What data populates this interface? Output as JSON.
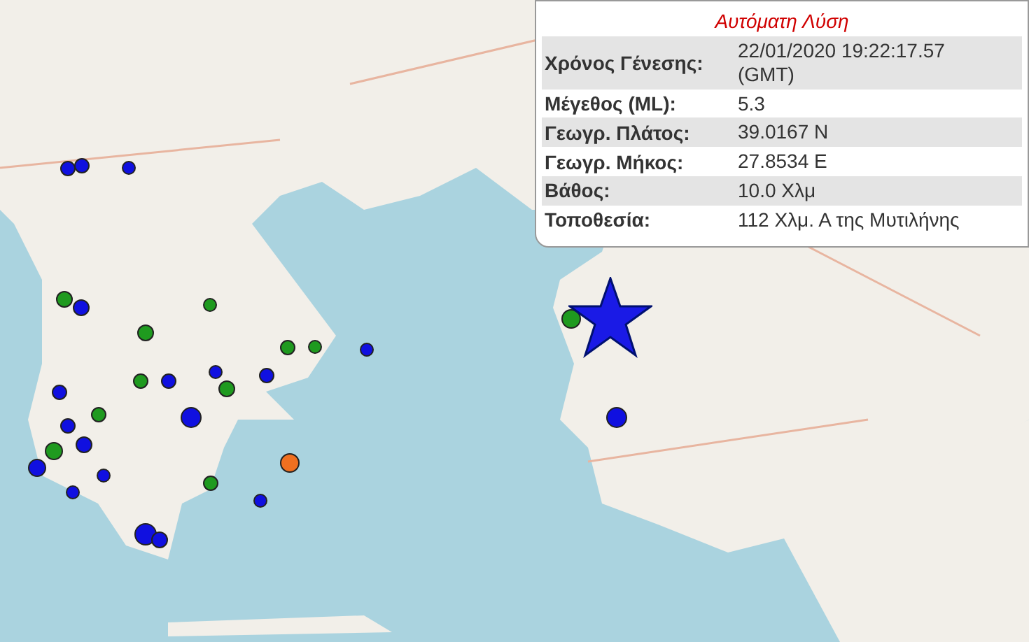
{
  "popup": {
    "title": "Αυτόματη Λύση",
    "rows": [
      {
        "label": "Χρόνος Γένεσης:",
        "value": "22/01/2020 19:22:17.57 (GMT)"
      },
      {
        "label": "Μέγεθος (ML):",
        "value": "5.3"
      },
      {
        "label": "Γεωγρ. Πλάτος:",
        "value": "39.0167 N"
      },
      {
        "label": "Γεωγρ. Μήκος:",
        "value": "27.8534 E"
      },
      {
        "label": "Βάθος:",
        "value": "10.0 Χλμ"
      },
      {
        "label": "Τοποθεσία:",
        "value": "112 Χλμ. Α της Μυτιλήνης"
      }
    ]
  },
  "markers": [
    {
      "color": "#1010e0"
    },
    {
      "color": "#1010e0"
    },
    {
      "color": "#1010e0"
    },
    {
      "color": "#1010e0"
    },
    {
      "color": "#1010e0"
    },
    {
      "color": "#1010e0"
    },
    {
      "color": "#1010e0"
    },
    {
      "color": "#1010e0"
    },
    {
      "color": "#1010e0"
    },
    {
      "color": "#1010e0"
    },
    {
      "color": "#1010e0"
    },
    {
      "color": "#1010e0"
    },
    {
      "color": "#1010e0"
    },
    {
      "color": "#1010e0"
    },
    {
      "color": "#1010e0"
    },
    {
      "color": "#1010e0"
    },
    {
      "color": "#1010e0"
    },
    {
      "color": "#1010e0"
    },
    {
      "color": "#1010e0"
    },
    {
      "color": "#1f9a1f"
    },
    {
      "color": "#1f9a1f"
    },
    {
      "color": "#1f9a1f"
    },
    {
      "color": "#1f9a1f"
    },
    {
      "color": "#1f9a1f"
    },
    {
      "color": "#1f9a1f"
    },
    {
      "color": "#1f9a1f"
    },
    {
      "color": "#1f9a1f"
    },
    {
      "color": "#1f9a1f"
    },
    {
      "color": "#1f9a1f"
    },
    {
      "color": "#1f9a1f"
    },
    {
      "color": "#f07020"
    }
  ]
}
